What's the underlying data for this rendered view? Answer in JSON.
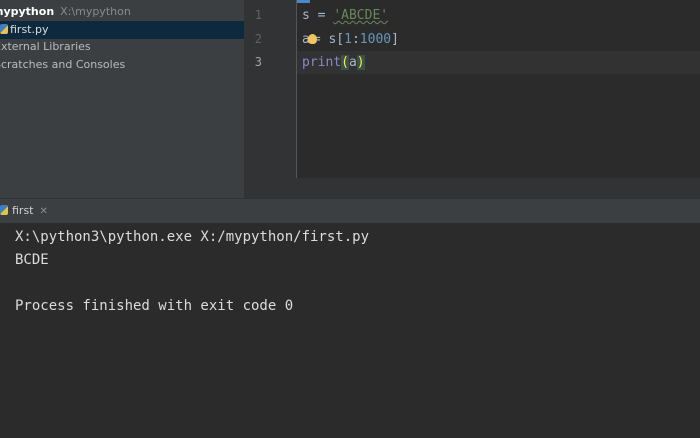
{
  "project": {
    "root_name": "mypython",
    "root_path": "X:\\mypython",
    "file_name": "first.py",
    "external_libraries": "External Libraries",
    "scratches": "Scratches and Consoles"
  },
  "editor": {
    "line_numbers": [
      "1",
      "2",
      "3"
    ],
    "line1": {
      "var": "s",
      "op": " = ",
      "string": "'ABCDE'"
    },
    "line2": {
      "var": "a",
      "op": "= ",
      "obj": "s[",
      "start": "1",
      "colon": ":",
      "end": "1000",
      "close": "]"
    },
    "line3": {
      "func": "print",
      "open": "(",
      "arg": "a",
      "close": ")"
    }
  },
  "run": {
    "tab_label": "first",
    "output": [
      "X:\\python3\\python.exe X:/mypython/first.py",
      "BCDE",
      "",
      "Process finished with exit code 0"
    ]
  }
}
